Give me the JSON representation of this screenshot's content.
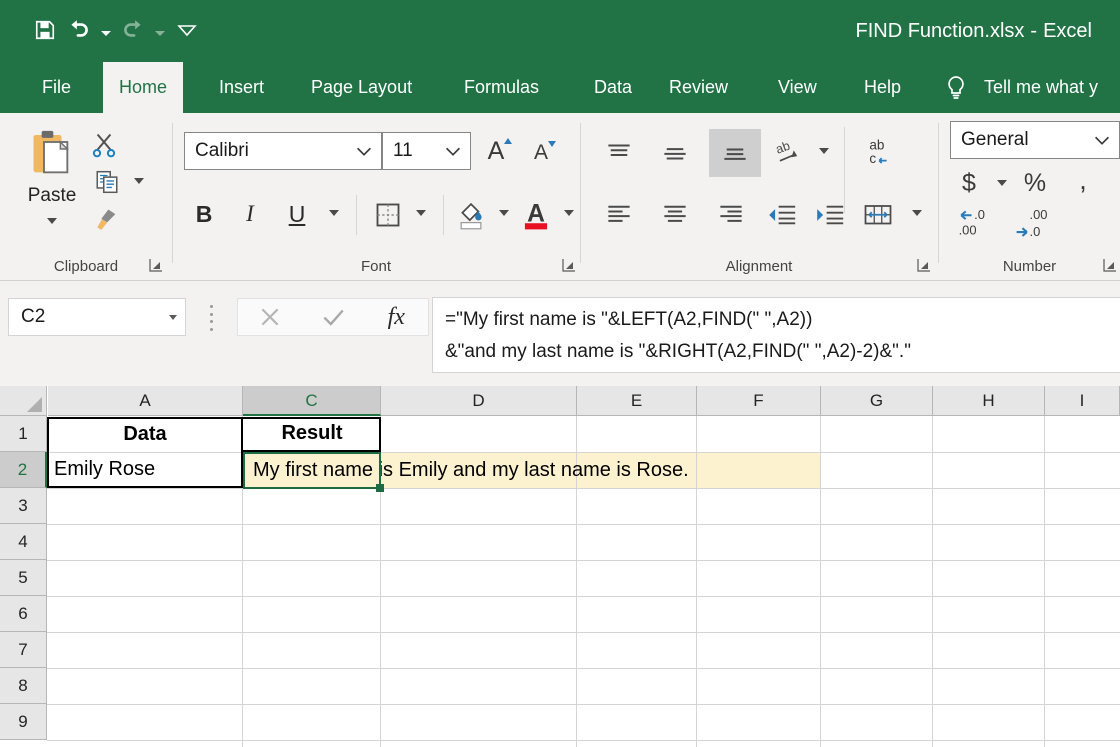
{
  "window": {
    "title": "FIND Function.xlsx",
    "separator": "-",
    "app": "Excel",
    "brand_color": "#217346"
  },
  "quick_access": {
    "items": [
      {
        "name": "save-icon",
        "label": "Save"
      },
      {
        "name": "undo-icon",
        "label": "Undo"
      },
      {
        "name": "undo-dropdown-icon",
        "label": "Undo options"
      },
      {
        "name": "redo-icon",
        "label": "Redo"
      },
      {
        "name": "redo-dropdown-icon",
        "label": "Redo options"
      },
      {
        "name": "customize-quick-access-icon",
        "label": "Customize Quick Access Toolbar"
      }
    ]
  },
  "ribbon_tabs": {
    "items": [
      {
        "label": "File",
        "active": false
      },
      {
        "label": "Home",
        "active": true
      },
      {
        "label": "Insert",
        "active": false
      },
      {
        "label": "Page Layout",
        "active": false
      },
      {
        "label": "Formulas",
        "active": false
      },
      {
        "label": "Data",
        "active": false
      },
      {
        "label": "Review",
        "active": false
      },
      {
        "label": "View",
        "active": false
      },
      {
        "label": "Help",
        "active": false
      }
    ],
    "tell_me": "Tell me what y"
  },
  "ribbon": {
    "groups": [
      {
        "label": "Clipboard"
      },
      {
        "label": "Font"
      },
      {
        "label": "Alignment"
      },
      {
        "label": "Number"
      }
    ],
    "clipboard": {
      "paste_label": "Paste",
      "cut_label": "Cut",
      "copy_label": "Copy",
      "format_painter_label": "Format Painter"
    },
    "font": {
      "font_family_value": "Calibri",
      "font_size_value": "11",
      "bold_label": "B",
      "italic_label": "I",
      "underline_label": "U",
      "increase_size_label": "A",
      "decrease_size_label": "A",
      "borders_label": "Borders",
      "fill_color_label": "Fill Color",
      "font_color_label": "Font Color",
      "font_color_hex": "#e81123"
    },
    "alignment": {
      "top_align_label": "Top Align",
      "middle_align_label": "Middle Align",
      "bottom_align_label": "Bottom Align",
      "orientation_label": "Orientation",
      "wrap_text_label": "Wrap Text",
      "align_left_label": "Align Left",
      "align_center_label": "Center",
      "align_right_label": "Align Right",
      "decrease_indent_label": "Decrease Indent",
      "increase_indent_label": "Increase Indent",
      "merge_center_label": "Merge & Center"
    },
    "number": {
      "format_value": "General",
      "currency_label": "$",
      "percent_label": "%",
      "comma_label": ",",
      "increase_decimal_label": "Increase Decimal",
      "decrease_decimal_label": "Decrease Decimal"
    }
  },
  "formula_bar": {
    "name_box_value": "C2",
    "cancel_label": "Cancel",
    "enter_label": "Enter",
    "insert_function_label": "fx",
    "formula_line1": "=\"My first name is \"&LEFT(A2,FIND(\" \",A2))",
    "formula_line2": "&\"and my last name is \"&RIGHT(A2,FIND(\" \",A2)-2)&\".\""
  },
  "sheet": {
    "column_headers": [
      "A",
      "C",
      "D",
      "E",
      "F",
      "G",
      "H",
      "I"
    ],
    "row_headers": [
      "1",
      "2",
      "3",
      "4",
      "5",
      "6",
      "7",
      "8",
      "9"
    ],
    "selected_column": "C",
    "selected_row": "2",
    "cells": {
      "a1": "Data",
      "c1": "Result",
      "a2": "Emily Rose",
      "c2": "My first name is Emily and my last name is Rose."
    },
    "highlight_color": "#fdf2cf",
    "selection_color": "#1d6b42"
  }
}
